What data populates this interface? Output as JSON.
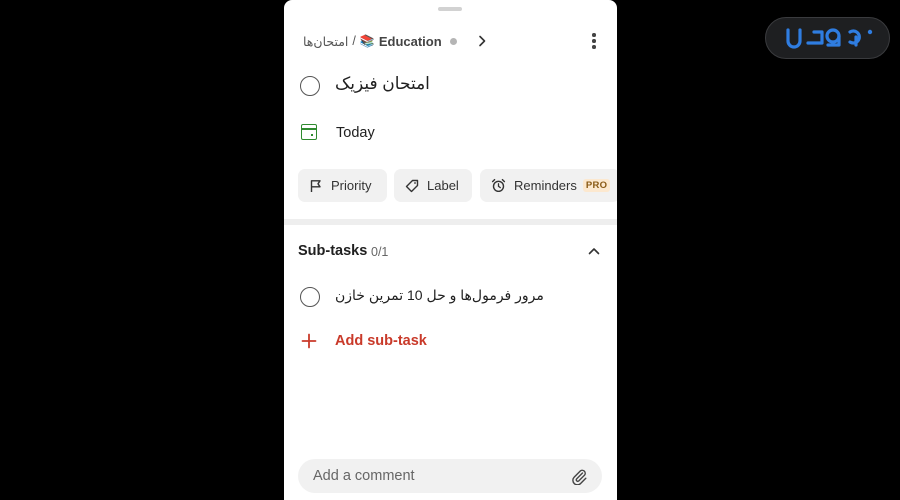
{
  "brand": {
    "logo_text": "Uبایا",
    "logo_color": "#2f7de1"
  },
  "breadcrumb": {
    "parent": "امتحان‌ها",
    "separator": "/",
    "project_emoji": "📚",
    "project": "Education"
  },
  "task": {
    "title": "امتحان فیزیک",
    "due_label": "Today",
    "due_color": "#2f8a2f"
  },
  "chips": {
    "priority": "Priority",
    "label": "Label",
    "reminders": "Reminders",
    "pro_badge": "PRO"
  },
  "subtasks": {
    "title": "Sub-tasks",
    "count": "0/1",
    "items": [
      {
        "text": "مرور فرمول‌ها و حل 10 تمرین خازن"
      }
    ],
    "add_label": "Add sub-task",
    "accent_color": "#c93a2a"
  },
  "comment": {
    "placeholder": "Add a comment"
  },
  "icons": {
    "more": "more-vertical-icon",
    "attach": "paperclip-icon",
    "calendar": "calendar-icon",
    "flag": "flag-icon",
    "tag": "tag-icon",
    "alarm": "alarm-clock-icon"
  }
}
